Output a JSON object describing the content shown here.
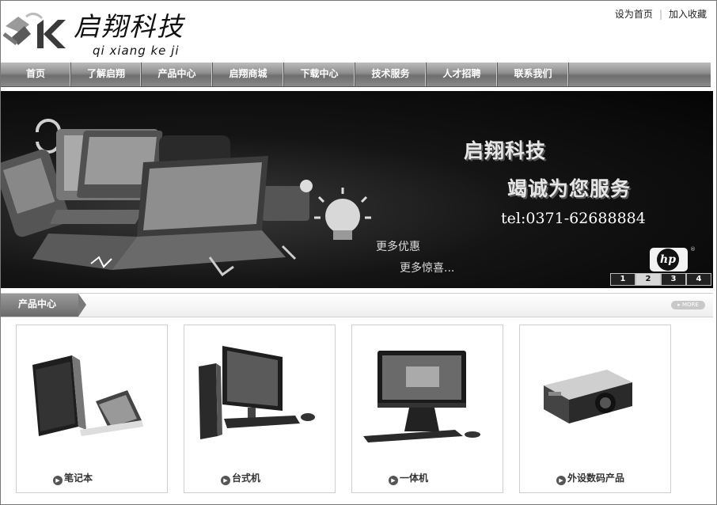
{
  "header": {
    "logo_name": "启翔科技",
    "logo_pinyin": "qi xiang ke ji",
    "top_links": [
      "设为首页",
      "加入收藏"
    ]
  },
  "nav": {
    "items": [
      "首页",
      "了解启翔",
      "产品中心",
      "启翔商城",
      "下载中心",
      "技术服务",
      "人才招聘",
      "联系我们"
    ]
  },
  "banner": {
    "title": "启翔科技",
    "slogan": "竭诚为您服务",
    "tel": "tel:0371-62688884",
    "promo1": "更多优惠",
    "promo2": "更多惊喜...",
    "brand_logo": "hp",
    "brand_reg": "®",
    "slides": [
      "1",
      "2",
      "3",
      "4"
    ],
    "active_slide": "2"
  },
  "products_section": {
    "title": "产品中心",
    "more": "MORE",
    "items": [
      {
        "label": "笔记本",
        "icon": "laptop-image"
      },
      {
        "label": "台式机",
        "icon": "desktop-image"
      },
      {
        "label": "一体机",
        "icon": "all-in-one-image"
      },
      {
        "label": "外设数码产品",
        "icon": "projector-image"
      }
    ]
  },
  "colors": {
    "nav_bg": "#8c8c8c",
    "banner_bg": "#0a0a0a",
    "section_tab": "#7a7a7a"
  }
}
